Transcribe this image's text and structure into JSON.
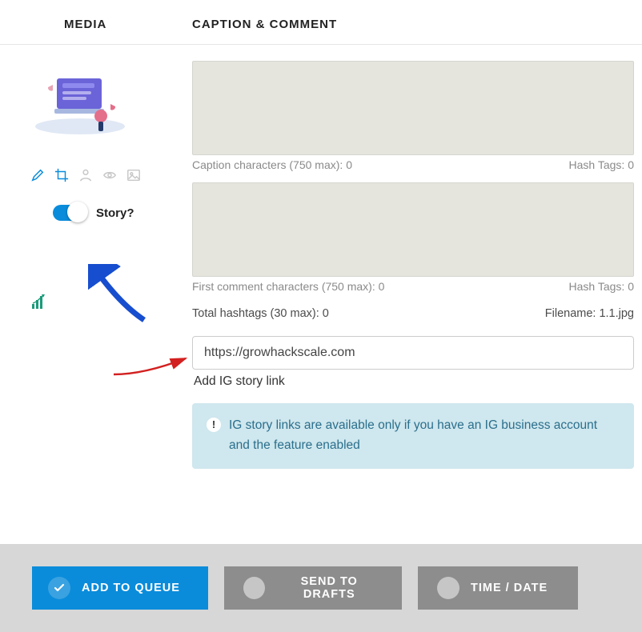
{
  "header": {
    "media_label": "MEDIA",
    "caption_label": "CAPTION & COMMENT"
  },
  "media": {
    "story_toggle_label": "Story?",
    "story_toggle_on": true
  },
  "caption": {
    "caption_counter": "Caption characters (750 max): 0",
    "caption_hashtags": "Hash Tags: 0",
    "comment_counter": "First comment characters (750 max): 0",
    "comment_hashtags": "Hash Tags: 0",
    "total_hashtags": "Total hashtags (30 max): 0",
    "filename_label": "Filename: 1.1.jpg",
    "story_link_value": "https://growhackscale.com",
    "story_link_label": "Add IG story link",
    "info_text": "IG story links are available only if you have an IG business account and the feature enabled"
  },
  "footer": {
    "queue_label": "ADD TO QUEUE",
    "drafts_label": "SEND TO DRAFTS",
    "time_label": "TIME / DATE"
  }
}
